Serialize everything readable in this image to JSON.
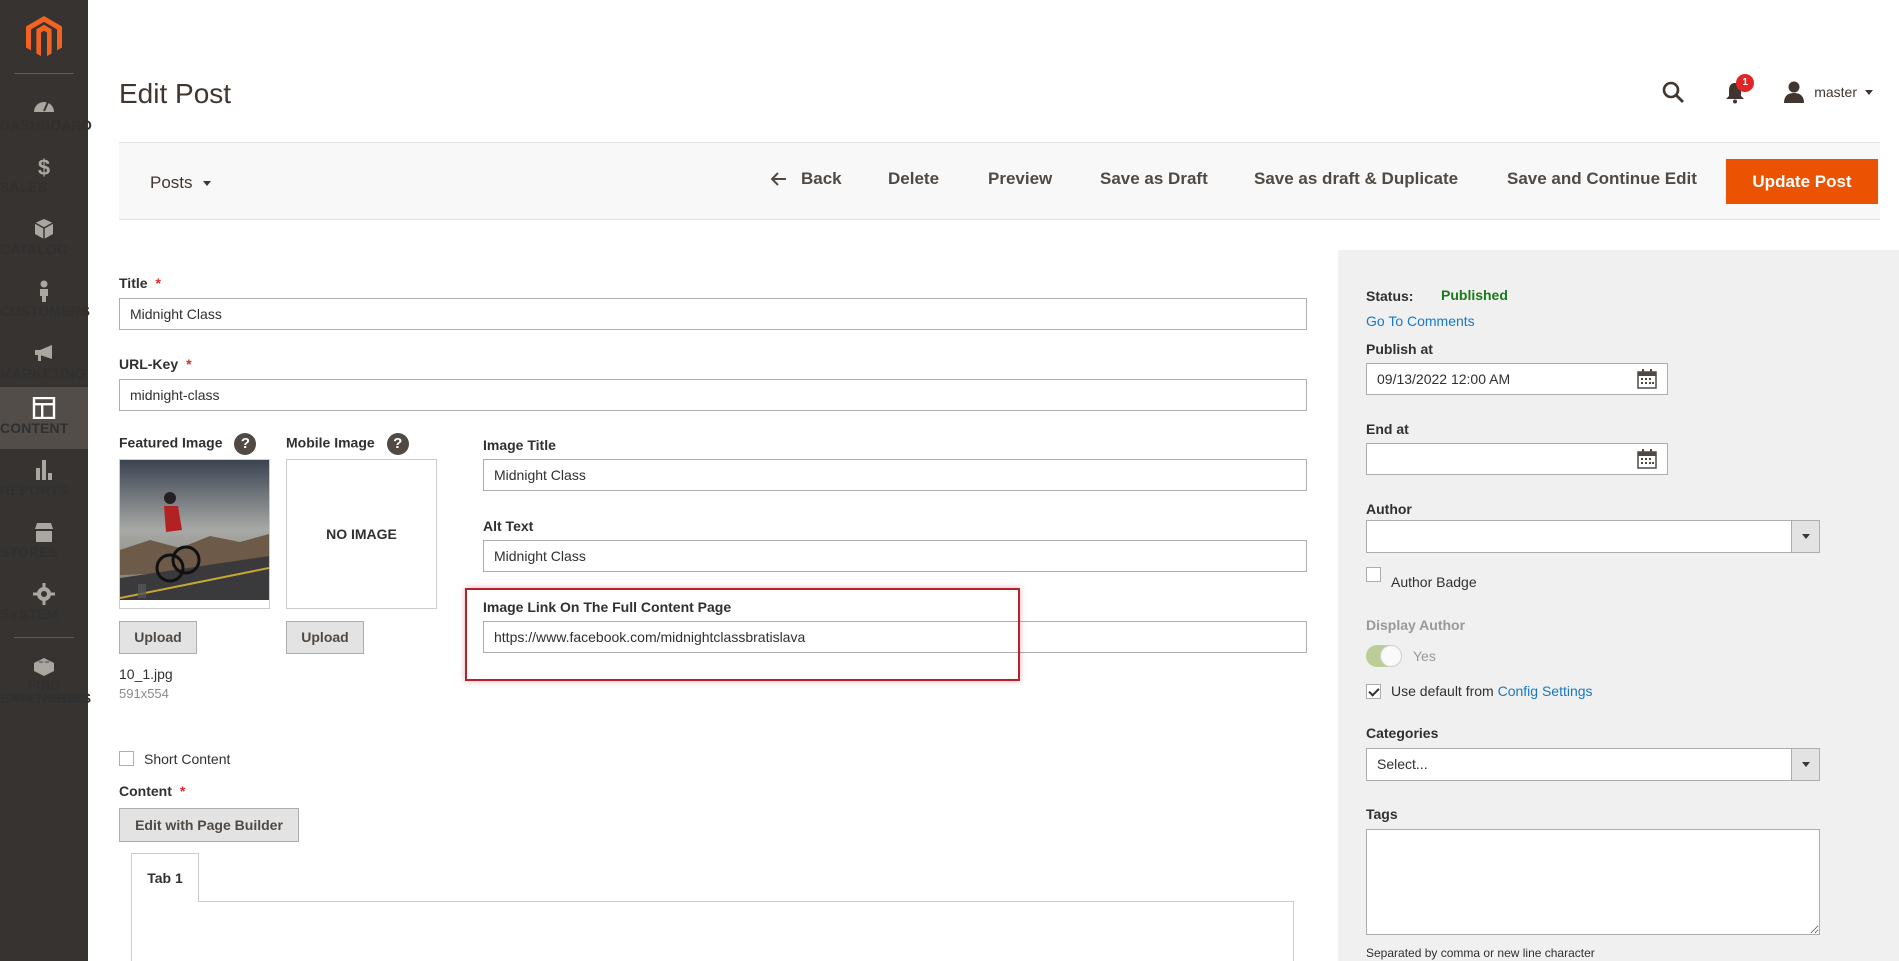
{
  "sidebar": {
    "logo": "magento-logo",
    "items": [
      {
        "label": "DASHBOARD",
        "icon": "dashboard-icon"
      },
      {
        "label": "SALES",
        "icon": "dollar-icon"
      },
      {
        "label": "CATALOG",
        "icon": "box-icon"
      },
      {
        "label": "CUSTOMERS",
        "icon": "person-icon"
      },
      {
        "label": "MARKETING",
        "icon": "megaphone-icon"
      },
      {
        "label": "CONTENT",
        "icon": "layout-icon",
        "active": true
      },
      {
        "label": "REPORTS",
        "icon": "bar-chart-icon"
      },
      {
        "label": "STORES",
        "icon": "storefront-icon"
      },
      {
        "label": "SYSTEM",
        "icon": "gear-icon"
      }
    ],
    "extensions": {
      "line1": "FIND PARTNERS",
      "line2": "& EXTENSIONS",
      "icon": "lego-brick-icon"
    }
  },
  "header": {
    "title": "Edit Post",
    "notifications_count": "1",
    "username": "master"
  },
  "toolbar": {
    "switcher": "Posts",
    "back": "Back",
    "delete": "Delete",
    "preview": "Preview",
    "save_draft": "Save as Draft",
    "save_draft_duplicate": "Save as draft & Duplicate",
    "save_continue": "Save and Continue Edit",
    "update": "Update Post"
  },
  "form": {
    "title": {
      "label": "Title",
      "value": "Midnight Class",
      "required": true
    },
    "url_key": {
      "label": "URL-Key",
      "value": "midnight-class",
      "required": true
    },
    "featured_image": {
      "label": "Featured Image",
      "file_name": "10_1.jpg",
      "dimensions": "591x554",
      "upload": "Upload"
    },
    "mobile_image": {
      "label": "Mobile Image",
      "placeholder": "NO IMAGE",
      "upload": "Upload"
    },
    "image_title": {
      "label": "Image Title",
      "value": "Midnight Class"
    },
    "alt_text": {
      "label": "Alt Text",
      "value": "Midnight Class"
    },
    "image_link": {
      "label": "Image Link On The Full Content Page",
      "value": "https://www.facebook.com/midnightclassbratislava"
    },
    "short_content": {
      "label": "Short Content",
      "checked": false
    },
    "content": {
      "label": "Content",
      "required": true,
      "page_builder": "Edit with Page Builder",
      "tab": "Tab 1"
    }
  },
  "side": {
    "status_label": "Status:",
    "status_value": "Published",
    "status_color": "#1a7a1a",
    "go_to_comments": "Go To Comments",
    "publish_at": {
      "label": "Publish at",
      "value": "09/13/2022 12:00 AM"
    },
    "end_at": {
      "label": "End at",
      "value": ""
    },
    "author": {
      "label": "Author",
      "value": ""
    },
    "author_badge": {
      "label": "Author Badge",
      "checked": false
    },
    "display_author": {
      "label": "Display Author",
      "toggle_value": "Yes",
      "enabled": true
    },
    "use_default": {
      "prefix": "Use default from ",
      "link": "Config Settings",
      "checked": true
    },
    "categories": {
      "label": "Categories",
      "value": "Select..."
    },
    "tags": {
      "label": "Tags",
      "value": "",
      "hint": "Separated by comma or new line character"
    }
  },
  "colors": {
    "accent": "#eb5202",
    "sidebar_bg": "#373330",
    "highlight": "#b4222c",
    "link": "#1979c3"
  }
}
